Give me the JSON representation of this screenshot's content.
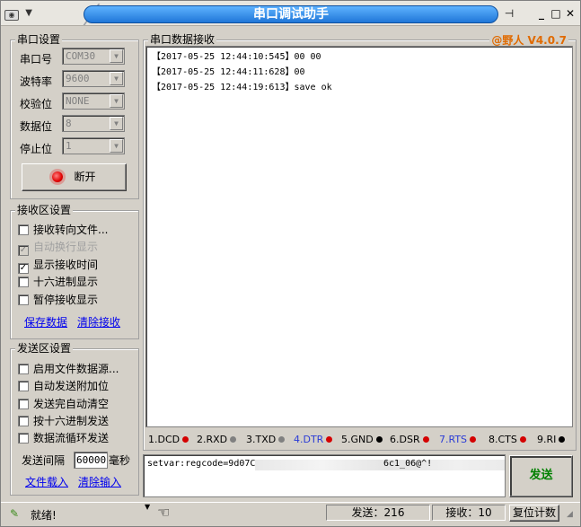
{
  "window": {
    "title": "串口调试助手"
  },
  "serial_settings": {
    "group_title": "串口设置",
    "fields": [
      {
        "label": "串口号",
        "value": "COM30"
      },
      {
        "label": "波特率",
        "value": "9600"
      },
      {
        "label": "校验位",
        "value": "NONE"
      },
      {
        "label": "数据位",
        "value": "8"
      },
      {
        "label": "停止位",
        "value": "1"
      }
    ],
    "toggle_button_label": "断开"
  },
  "receive_settings": {
    "group_title": "接收区设置",
    "options": [
      {
        "label": "接收转向文件...",
        "checked": false,
        "enabled": true
      },
      {
        "label": "自动换行显示",
        "checked": true,
        "enabled": false
      },
      {
        "label": "显示接收时间",
        "checked": true,
        "enabled": true
      },
      {
        "label": "十六进制显示",
        "checked": false,
        "enabled": true
      },
      {
        "label": "暂停接收显示",
        "checked": false,
        "enabled": true
      }
    ],
    "save_link": "保存数据",
    "clear_link": "清除接收"
  },
  "send_settings": {
    "group_title": "发送区设置",
    "options": [
      {
        "label": "启用文件数据源...",
        "checked": false
      },
      {
        "label": "自动发送附加位",
        "checked": false
      },
      {
        "label": "发送完自动清空",
        "checked": false
      },
      {
        "label": "按十六进制发送",
        "checked": false
      },
      {
        "label": "数据流循环发送",
        "checked": false
      }
    ],
    "interval_label": "发送间隔",
    "interval_value": "60000",
    "interval_unit": "毫秒",
    "load_file_link": "文件载入",
    "clear_input_link": "清除输入"
  },
  "receive_area": {
    "group_title": "串口数据接收",
    "brand": "@野人 V4.0.7",
    "lines": [
      "【2017-05-25 12:44:10:545】00 00",
      "【2017-05-25 12:44:11:628】00",
      "【2017-05-25 12:44:19:613】save ok"
    ]
  },
  "signals": [
    {
      "label": "1.DCD",
      "color": "#d40000",
      "highlight": false
    },
    {
      "label": "2.RXD",
      "color": "#808080",
      "highlight": false
    },
    {
      "label": "3.TXD",
      "color": "#808080",
      "highlight": false
    },
    {
      "label": "4.DTR",
      "color": "#d40000",
      "highlight": true
    },
    {
      "label": "5.GND",
      "color": "#000000",
      "highlight": false
    },
    {
      "label": "6.DSR",
      "color": "#d40000",
      "highlight": false
    },
    {
      "label": "7.RTS",
      "color": "#d40000",
      "highlight": true
    },
    {
      "label": "8.CTS",
      "color": "#d40000",
      "highlight": false
    },
    {
      "label": "9.RI",
      "color": "#000000",
      "highlight": false
    }
  ],
  "send_area": {
    "text_start": "setvar:regcode=9d07C",
    "text_end": "6c1_06@^!",
    "send_button_label": "发送"
  },
  "status": {
    "ready_text": "就绪!",
    "sent_text": "发送：216",
    "received_text": "接收：10",
    "reset_label": "复位计数"
  },
  "colors": {
    "title_bar": "#1f76d8",
    "brand": "#e06a00",
    "send_button_text": "#008000",
    "link": "#0000ee",
    "highlight_signal": "#2a3bd6"
  }
}
